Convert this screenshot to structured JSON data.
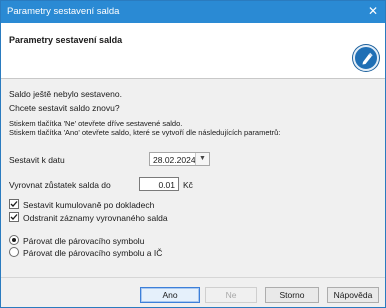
{
  "window": {
    "title": "Parametry sestavení salda",
    "close_glyph": "✕"
  },
  "header": {
    "title": "Parametry sestavení salda",
    "icon": "saldo-wizard-icon"
  },
  "info": {
    "line1": "Saldo ještě nebylo sestaveno.",
    "line2": "Chcete sestavit saldo znovu?",
    "line3": "Stiskem tlačítka 'Ne' otevřete dříve sestavené saldo.",
    "line4": "Stiskem tlačítka 'Ano' otevřete saldo, které se vytvoří dle následujících parametrů:"
  },
  "form": {
    "date_label": "Sestavit k datu",
    "date_value": "28.02.2024",
    "balance_label": "Vyrovnat zůstatek salda do",
    "balance_value": "0.01",
    "balance_unit": "Kč",
    "checkbox1_label": "Sestavit kumulovaně po dokladech",
    "checkbox1_checked": true,
    "checkbox2_label": "Odstranit záznamy vyrovnaného salda",
    "checkbox2_checked": true,
    "radio1_label": "Párovat dle párovacího symbolu",
    "radio1_selected": true,
    "radio2_label": "Párovat dle párovacího symbolu a IČ",
    "radio2_selected": false
  },
  "buttons": {
    "yes": "Ano",
    "no": "Ne",
    "cancel": "Storno",
    "help": "Nápověda"
  }
}
